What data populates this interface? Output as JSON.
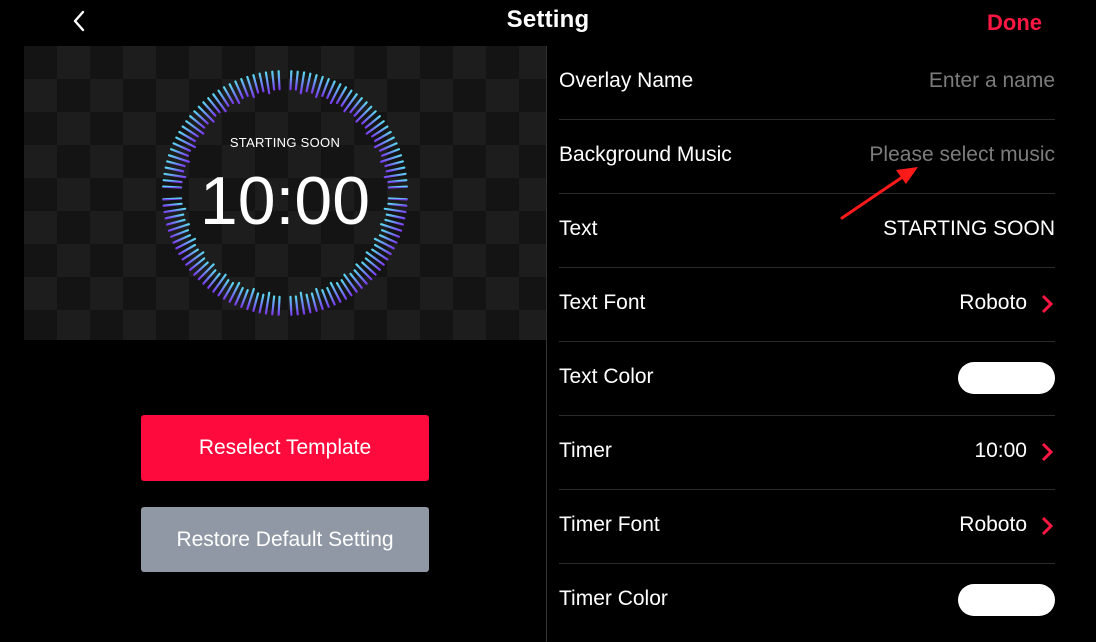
{
  "header": {
    "back_icon": "chevron-left-icon",
    "title": "Setting",
    "done_label": "Done"
  },
  "colors": {
    "accent": "#ff1744",
    "primary_button": "#ff0a3d",
    "secondary_button": "#8f98a4",
    "ring_gradient": [
      "#5ad7f0",
      "#7b3cf0"
    ]
  },
  "preview": {
    "overlay_text": "STARTING SOON",
    "timer": "10:00"
  },
  "buttons": {
    "reselect_label": "Reselect Template",
    "restore_label": "Restore Default Setting"
  },
  "settings": {
    "overlay_name": {
      "label": "Overlay Name",
      "placeholder": "Enter a name"
    },
    "background_music": {
      "label": "Background Music",
      "placeholder": "Please select music"
    },
    "text": {
      "label": "Text",
      "value": "STARTING SOON"
    },
    "text_font": {
      "label": "Text Font",
      "value": "Roboto",
      "icon": "chevron-right-icon"
    },
    "text_color": {
      "label": "Text Color",
      "color": "#ffffff"
    },
    "timer": {
      "label": "Timer",
      "value": "10:00",
      "icon": "chevron-right-icon"
    },
    "timer_font": {
      "label": "Timer Font",
      "value": "Roboto",
      "icon": "chevron-right-icon"
    },
    "timer_color": {
      "label": "Timer Color",
      "color": "#ffffff"
    }
  }
}
